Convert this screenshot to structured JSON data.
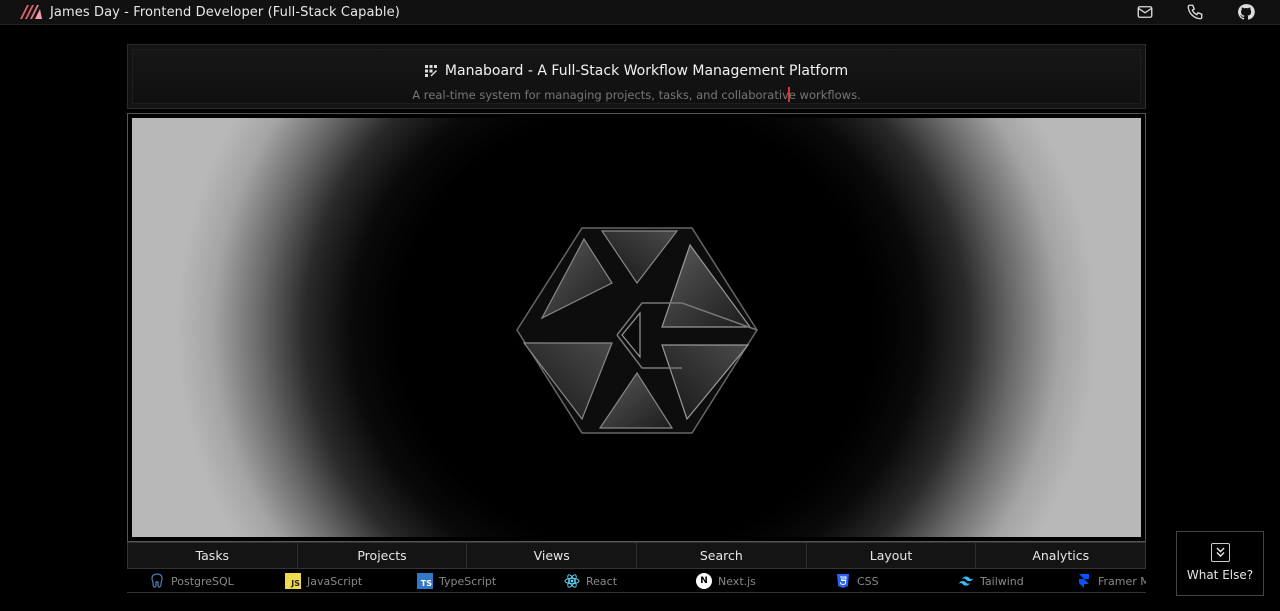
{
  "header": {
    "site_title": "James Day - Frontend Developer (Full-Stack Capable)",
    "icons": [
      "mail-icon",
      "phone-icon",
      "github-icon"
    ]
  },
  "project": {
    "title": "Manaboard - A Full-Stack Workflow Management Platform",
    "subtitle_part1": "A real-time system for managing projects, tasks, and collaborativ",
    "subtitle_part2": "e workflows."
  },
  "tabs": [
    {
      "label": "Tasks"
    },
    {
      "label": "Projects"
    },
    {
      "label": "Views"
    },
    {
      "label": "Search"
    },
    {
      "label": "Layout"
    },
    {
      "label": "Analytics"
    }
  ],
  "tech": [
    {
      "label": "PostgreSQL",
      "icon": "postgresql-icon"
    },
    {
      "label": "JavaScript",
      "icon": "javascript-icon",
      "badge": "JS"
    },
    {
      "label": "TypeScript",
      "icon": "typescript-icon",
      "badge": "TS"
    },
    {
      "label": "React",
      "icon": "react-icon"
    },
    {
      "label": "Next.js",
      "icon": "nextjs-icon",
      "badge": "N"
    },
    {
      "label": "CSS",
      "icon": "css-icon"
    },
    {
      "label": "Tailwind",
      "icon": "tailwind-icon"
    },
    {
      "label": "Framer M",
      "icon": "framer-icon"
    }
  ],
  "what_else": {
    "label": "What Else?"
  },
  "colors": {
    "accent": "#e0606a",
    "js_yellow": "#f0db4f",
    "ts_blue": "#3178c6",
    "react_cyan": "#61dafb",
    "css_blue": "#2965f1",
    "tailwind_teal": "#38bdf8",
    "framer_blue": "#0055ff"
  }
}
